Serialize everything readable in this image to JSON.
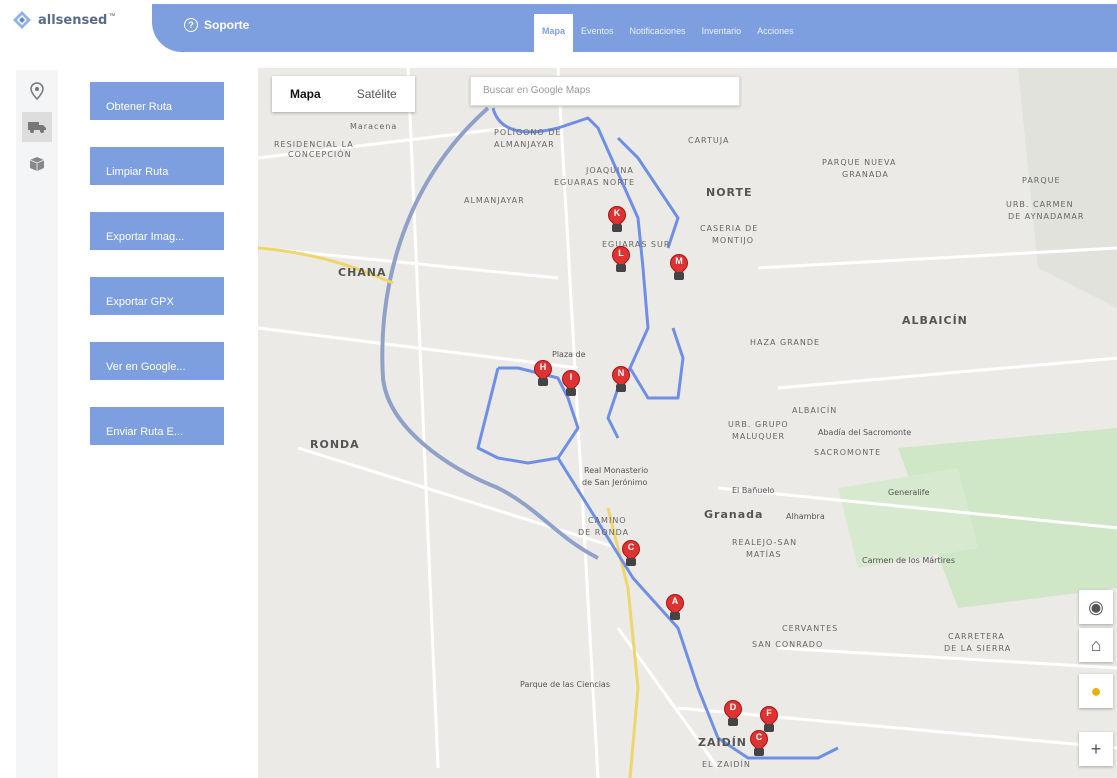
{
  "brand": {
    "name": "allsensed",
    "trademark": "™"
  },
  "nav": {
    "support_label": "Soporte",
    "tabs": [
      {
        "label": "Mapa",
        "active": true
      },
      {
        "label": "Eventos"
      },
      {
        "label": "Notificaciones"
      },
      {
        "label": "Inventario"
      },
      {
        "label": "Acciones"
      }
    ]
  },
  "sidebar_icons": [
    "location-pin-icon",
    "truck-icon",
    "box-icon"
  ],
  "actions": [
    {
      "label": "Obtener Ruta"
    },
    {
      "label": "Limpiar Ruta"
    },
    {
      "label": "Exportar Imag..."
    },
    {
      "label": "Exportar GPX"
    },
    {
      "label": "Ver en Google..."
    },
    {
      "label": "Enviar Ruta E..."
    }
  ],
  "map": {
    "type_options": [
      {
        "label": "Mapa",
        "selected": true
      },
      {
        "label": "Satélite"
      }
    ],
    "search_placeholder": "Buscar en Google Maps",
    "labels": {
      "mar": "Maracena",
      "res": "RESIDENCIAL LA",
      "res2": "CONCEPCIÓN",
      "pol": "POLÍGONO DE",
      "pol2": "ALMANJAYAR",
      "cartuja": "CARTUJA",
      "joa": "JOAQUINA",
      "joa2": "EGUARAS NORTE",
      "norte": "NORTE",
      "parque": "PARQUE NUEVA",
      "parque2": "GRANADA",
      "alman": "ALMANJAYAR",
      "esur": "EGUARAS SUR",
      "cas": "CASERIA DE",
      "cas2": "MONTIJO",
      "chana": "CHANA",
      "albaicin": "ALBAICÍN",
      "haza": "HAZA GRANDE",
      "plaza": "Plaza de",
      "ronda": "RONDA",
      "alb2": "ALBAICÍN",
      "urb": "URB. GRUPO",
      "urb2": "MALUQUER",
      "abadia": "Abadía del Sacromonte",
      "sacro": "SACROMONTE",
      "real": "Real Monasterio",
      "real2": "de San Jerónimo",
      "banuelo": "El Bañuelo",
      "generalife": "Generalife",
      "granada": "Granada",
      "alhambra": "Alhambra",
      "camino": "CAMINO",
      "camino2": "DE RONDA",
      "realejo": "REALEJO-SAN",
      "realejo2": "MATÍAS",
      "carmen": "Carmen de los Mártires",
      "cervantes": "CERVANTES",
      "sanconrado": "SAN CONRADO",
      "carretera": "CARRETERA",
      "carretera2": "DE LA SIERRA",
      "ciencias": "Parque de las Ciencias",
      "zaidin": "ZAIDÍN",
      "elzaidin": "EL ZAIDÍN",
      "urbcarmen": "URB. CARMEN",
      "urbcarmen2": "DE AYNADAMAR",
      "parque3": "PARQUE"
    },
    "markers": [
      "K",
      "L",
      "M",
      "H",
      "I",
      "N",
      "C",
      "A",
      "D",
      "F",
      "C"
    ]
  }
}
